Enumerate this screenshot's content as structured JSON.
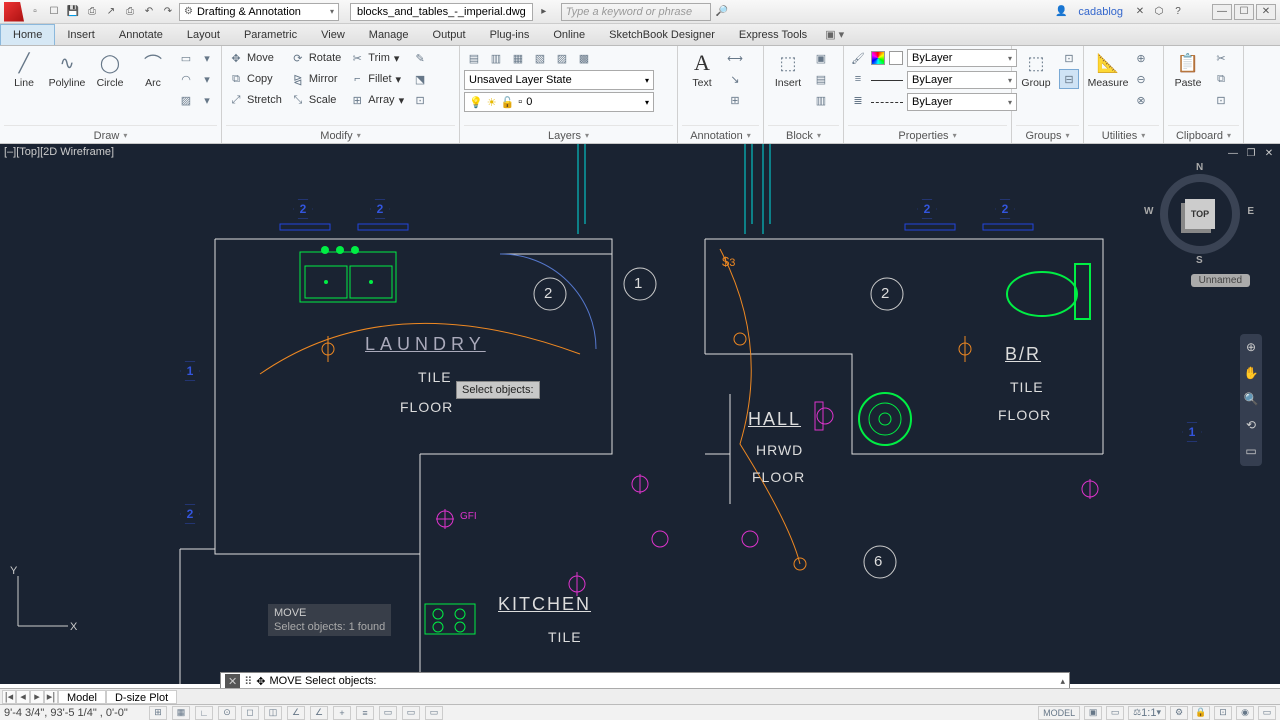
{
  "title": {
    "workspace": "Drafting & Annotation",
    "doc": "blocks_and_tables_-_imperial.dwg",
    "search_placeholder": "Type a keyword or phrase",
    "user": "cadablog"
  },
  "tabs": [
    "Home",
    "Insert",
    "Annotate",
    "Layout",
    "Parametric",
    "View",
    "Manage",
    "Output",
    "Plug-ins",
    "Online",
    "SketchBook Designer",
    "Express Tools"
  ],
  "ribbon": {
    "draw": {
      "title": "Draw",
      "items": [
        "Line",
        "Polyline",
        "Circle",
        "Arc"
      ]
    },
    "modify": {
      "title": "Modify",
      "rows": [
        [
          "Move",
          "Rotate",
          "Trim"
        ],
        [
          "Copy",
          "Mirror",
          "Fillet"
        ],
        [
          "Stretch",
          "Scale",
          "Array"
        ]
      ]
    },
    "layers": {
      "title": "Layers",
      "state": "Unsaved Layer State",
      "current": "0"
    },
    "annotation": {
      "title": "Annotation",
      "item": "Text"
    },
    "block": {
      "title": "Block",
      "item": "Insert"
    },
    "properties": {
      "title": "Properties",
      "color": "ByLayer",
      "lw": "ByLayer",
      "lt": "ByLayer"
    },
    "groups": {
      "title": "Groups",
      "item": "Group"
    },
    "utilities": {
      "title": "Utilities",
      "item": "Measure"
    },
    "clipboard": {
      "title": "Clipboard",
      "item": "Paste"
    }
  },
  "viewport": {
    "label": "[–][Top][2D Wireframe]",
    "viewcube_face": "TOP",
    "viewcube_chip": "Unnamed",
    "dirs": {
      "n": "N",
      "s": "S",
      "e": "E",
      "w": "W"
    }
  },
  "rooms": {
    "laundry": {
      "name": "LAUNDRY",
      "l1": "TILE",
      "l2": "FLOOR"
    },
    "hall": {
      "name": "HALL",
      "l1": "HRWD",
      "l2": "FLOOR"
    },
    "br": {
      "name": "B/R",
      "l1": "TILE",
      "l2": "FLOOR"
    },
    "kitchen": {
      "name": "KITCHEN",
      "l1": "TILE"
    }
  },
  "markers": {
    "m1": "1",
    "m2": "2",
    "m3": "3",
    "m6": "6",
    "gfi": "GFI"
  },
  "tooltip": "Select objects:",
  "cmd": {
    "hist1": "MOVE",
    "hist2": "Select objects: 1 found",
    "prompt": "MOVE Select objects:"
  },
  "sheets": {
    "model": "Model",
    "plot": "D-size Plot"
  },
  "status": {
    "coord": "9'-4 3/4\",  93'-5 1/4\" , 0'-0\"",
    "model": "MODEL",
    "scale": "1:1"
  }
}
